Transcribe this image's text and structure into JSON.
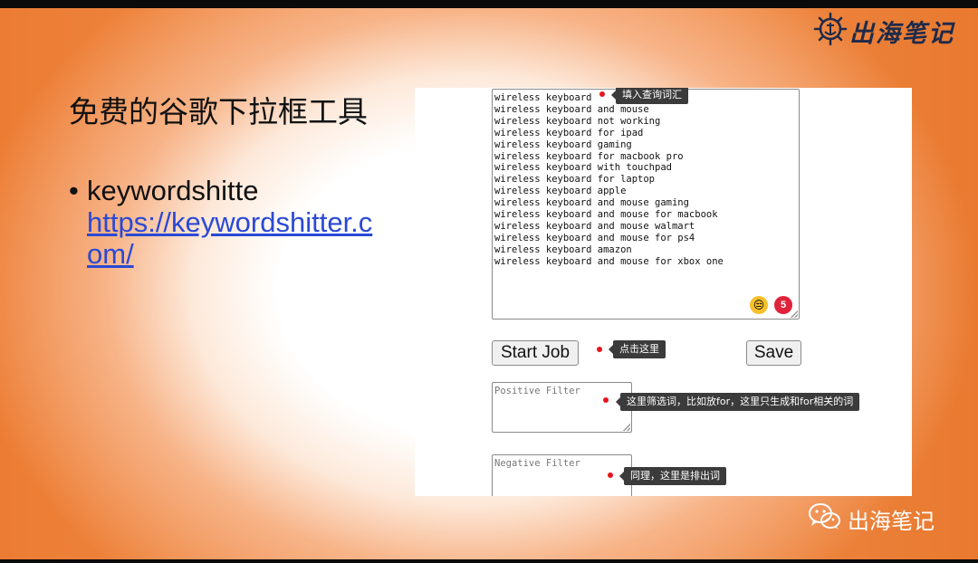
{
  "slide": {
    "title": "免费的谷歌下拉框工具",
    "bullet_text": "keywordshitte",
    "bullet_link": "https://keywordshitter.com/"
  },
  "logo": {
    "text": "出海笔记",
    "icon": "ship-wheel-anchor-icon"
  },
  "watermark": {
    "text": "出海笔记",
    "icon": "wechat-icon"
  },
  "tool": {
    "keywords": [
      "wireless keyboard",
      "wireless keyboard and mouse",
      "wireless keyboard not working",
      "wireless keyboard for ipad",
      "wireless keyboard gaming",
      "wireless keyboard for macbook pro",
      "wireless keyboard with touchpad",
      "wireless keyboard for laptop",
      "wireless keyboard apple",
      "wireless keyboard and mouse gaming",
      "wireless keyboard and mouse for macbook",
      "wireless keyboard and mouse walmart",
      "wireless keyboard and mouse for ps4",
      "wireless keyboard amazon",
      "wireless keyboard and mouse for xbox one"
    ],
    "emoji": "😒",
    "badge_count": "5",
    "start_label": "Start Job",
    "save_label": "Save",
    "positive_placeholder": "Positive Filter",
    "negative_placeholder": "Negative Filter"
  },
  "annotations": {
    "query": "填入查询词汇",
    "start": "点击这里",
    "positive": "这里筛选词，比如放for，这里只生成和for相关的词",
    "negative": "同理，这里是排出词"
  },
  "colors": {
    "accent_orange": "#ec7c33",
    "link_blue": "#2a49d6",
    "marker_red": "#e8141e",
    "tooltip_bg": "#3b3b3b"
  }
}
